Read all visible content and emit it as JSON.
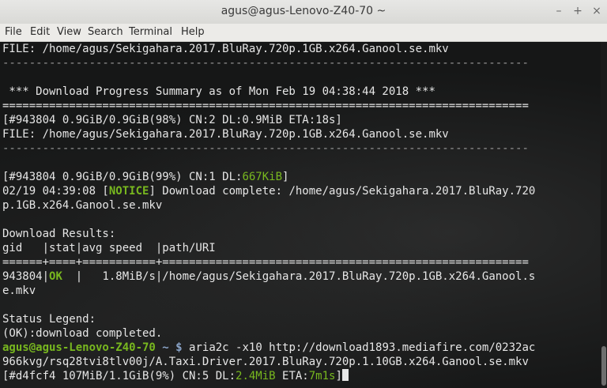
{
  "window": {
    "title": "agus@agus-Lenovo-Z40-70 ~",
    "controls": {
      "minimize": "–",
      "maximize": "+",
      "close": "×"
    }
  },
  "menu": [
    "File",
    "Edit",
    "View",
    "Search",
    "Terminal",
    "Help"
  ],
  "terminal": {
    "l1": "FILE: /home/agus/Sekigahara.2017.BluRay.720p.1GB.x264.Ganool.se.mkv",
    "l2": "-------------------------------------------------------------------------------",
    "l3": "",
    "l4": " *** Download Progress Summary as of Mon Feb 19 04:38:44 2018 ***",
    "l5": "===============================================================================",
    "l6": "[#943804 0.9GiB/0.9GiB(98%) CN:2 DL:0.9MiB ETA:18s]",
    "l7": "FILE: /home/agus/Sekigahara.2017.BluRay.720p.1GB.x264.Ganool.se.mkv",
    "l8": "-------------------------------------------------------------------------------",
    "l9": "",
    "l10a": "[#943804 0.9GiB/0.9GiB(99%) CN:1 DL:",
    "l10b": "667KiB",
    "l10c": "]",
    "l11a": "02/19 04:39:08 [",
    "l11b": "NOTICE",
    "l11c": "] Download complete: /home/agus/Sekigahara.2017.BluRay.720",
    "l12": "p.1GB.x264.Ganool.se.mkv",
    "l13": "",
    "l14": "Download Results:",
    "l15": "gid   |stat|avg speed  |path/URI",
    "l16": "======+====+===========+=======================================================",
    "l17a": "943804|",
    "l17b": "OK",
    "l17c": "  |   1.8MiB/s|/home/agus/Sekigahara.2017.BluRay.720p.1GB.x264.Ganool.s",
    "l18": "e.mkv",
    "l19": "",
    "l20": "Status Legend:",
    "l21": "(OK):download completed.",
    "prompt_user": "agus@agus-Lenovo-Z40-70",
    "prompt_path": " ~ $ ",
    "command": "aria2c -x10 http://download1893.mediafire.com/0232ac",
    "l23": "966kvg/rsq28tvi8tlv00j/A.Taxi.Driver.2017.BluRay.720p.1.10GB.x264.Ganool.se.mkv",
    "l24a": "[#d4fcf4 107MiB/1.1GiB(9%) CN:5 DL:",
    "l24b": "2.4MiB",
    "l24c": " ETA:",
    "l24d": "7m1s",
    "l24e": "]"
  },
  "colors": {
    "accent_green": "#78b81f",
    "terminal_bg": "#161717",
    "text": "#e6e6e6"
  }
}
